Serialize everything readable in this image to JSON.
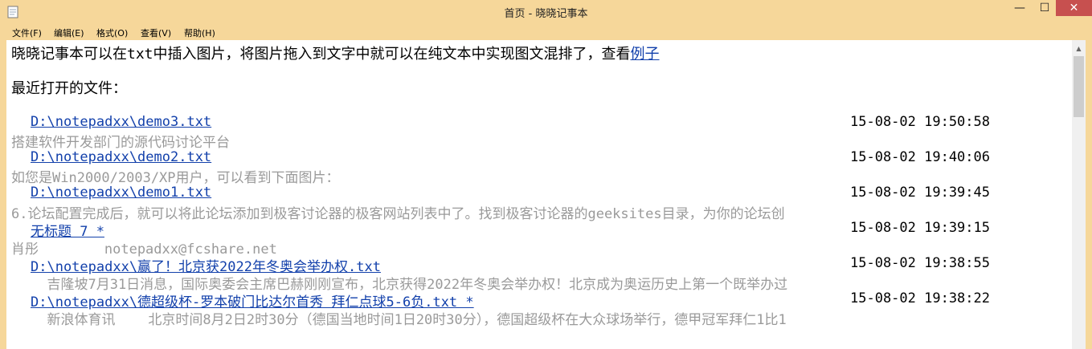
{
  "window": {
    "title": "首页 - 晓晓记事本",
    "min_glyph": "—",
    "max_glyph": "☐",
    "close_glyph": "✕"
  },
  "menu": [
    "文件(F)",
    "编辑(E)",
    "格式(O)",
    "查看(V)",
    "帮助(H)"
  ],
  "intro": {
    "text": "晓晓记事本可以在txt中插入图片，将图片拖入到文字中就可以在纯文本中实现图文混排了，查看",
    "link": "例子"
  },
  "recent_heading": "最近打开的文件：",
  "recent_files": [
    {
      "path": "D:\\notepadxx\\demo3.txt",
      "time": "15-08-02 19:50:58",
      "preview": "搭建软件开发部门的源代码讨论平台"
    },
    {
      "path": "D:\\notepadxx\\demo2.txt",
      "time": "15-08-02 19:40:06",
      "preview": "如您是Win2000/2003/XP用户，可以看到下面图片："
    },
    {
      "path": "D:\\notepadxx\\demo1.txt",
      "time": "15-08-02 19:39:45",
      "preview": "6.论坛配置完成后，就可以将此论坛添加到极客讨论器的极客网站列表中了。找到极客讨论器的geeksites目录，为你的论坛创"
    },
    {
      "path": "无标题 7 *",
      "time": "15-08-02 19:39:15",
      "preview": "肖彤        notepadxx@fcshare.net"
    },
    {
      "path": "D:\\notepadxx\\赢了！北京获2022年冬奥会举办权.txt",
      "time": "15-08-02 19:38:55",
      "preview": "  吉隆坡7月31日消息，国际奥委会主席巴赫刚刚宣布，北京获得2022年冬奥会举办权！北京成为奥运历史上第一个既举办过"
    },
    {
      "path": "D:\\notepadxx\\德超级杯-罗本破门比达尔首秀 拜仁点球5-6负.txt *",
      "time": "15-08-02 19:38:22",
      "preview": "  新浪体育讯    北京时间8月2日2时30分（德国当地时间1日20时30分），德国超级杯在大众球场举行，德甲冠军拜仁1比1"
    }
  ],
  "icons": {
    "app": "notepad-icon",
    "scroll_up": "scroll-up-arrow-icon"
  }
}
